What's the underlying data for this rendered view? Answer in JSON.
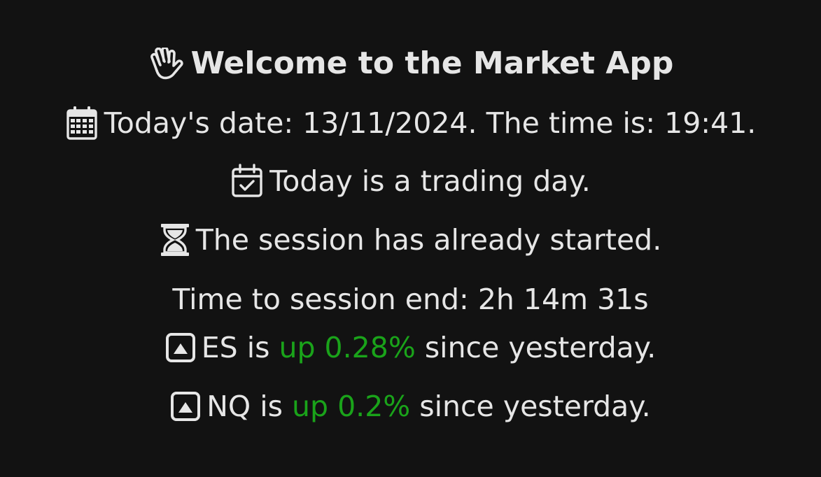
{
  "welcome": {
    "icon": "waving-hand-icon",
    "text": "Welcome to the Market App"
  },
  "date_line": {
    "icon": "calendar-icon",
    "text": "Today's date: 13/11/2024. The time is: 19:41."
  },
  "trading_line": {
    "icon": "calendar-check-icon",
    "text": "Today is a trading day."
  },
  "session_line": {
    "icon": "hourglass-icon",
    "text": "The session has already started."
  },
  "countdown": {
    "text": "Time to session end: 2h 14m 31s"
  },
  "instruments": [
    {
      "icon": "caret-up-square-icon",
      "prefix": "ES is ",
      "change": "up 0.28%",
      "suffix": " since yesterday."
    },
    {
      "icon": "caret-up-square-icon",
      "prefix": "NQ is ",
      "change": "up 0.2%",
      "suffix": " since yesterday."
    }
  ],
  "colors": {
    "background": "#121212",
    "text": "#e6e6e6",
    "up": "#1aa31a"
  }
}
